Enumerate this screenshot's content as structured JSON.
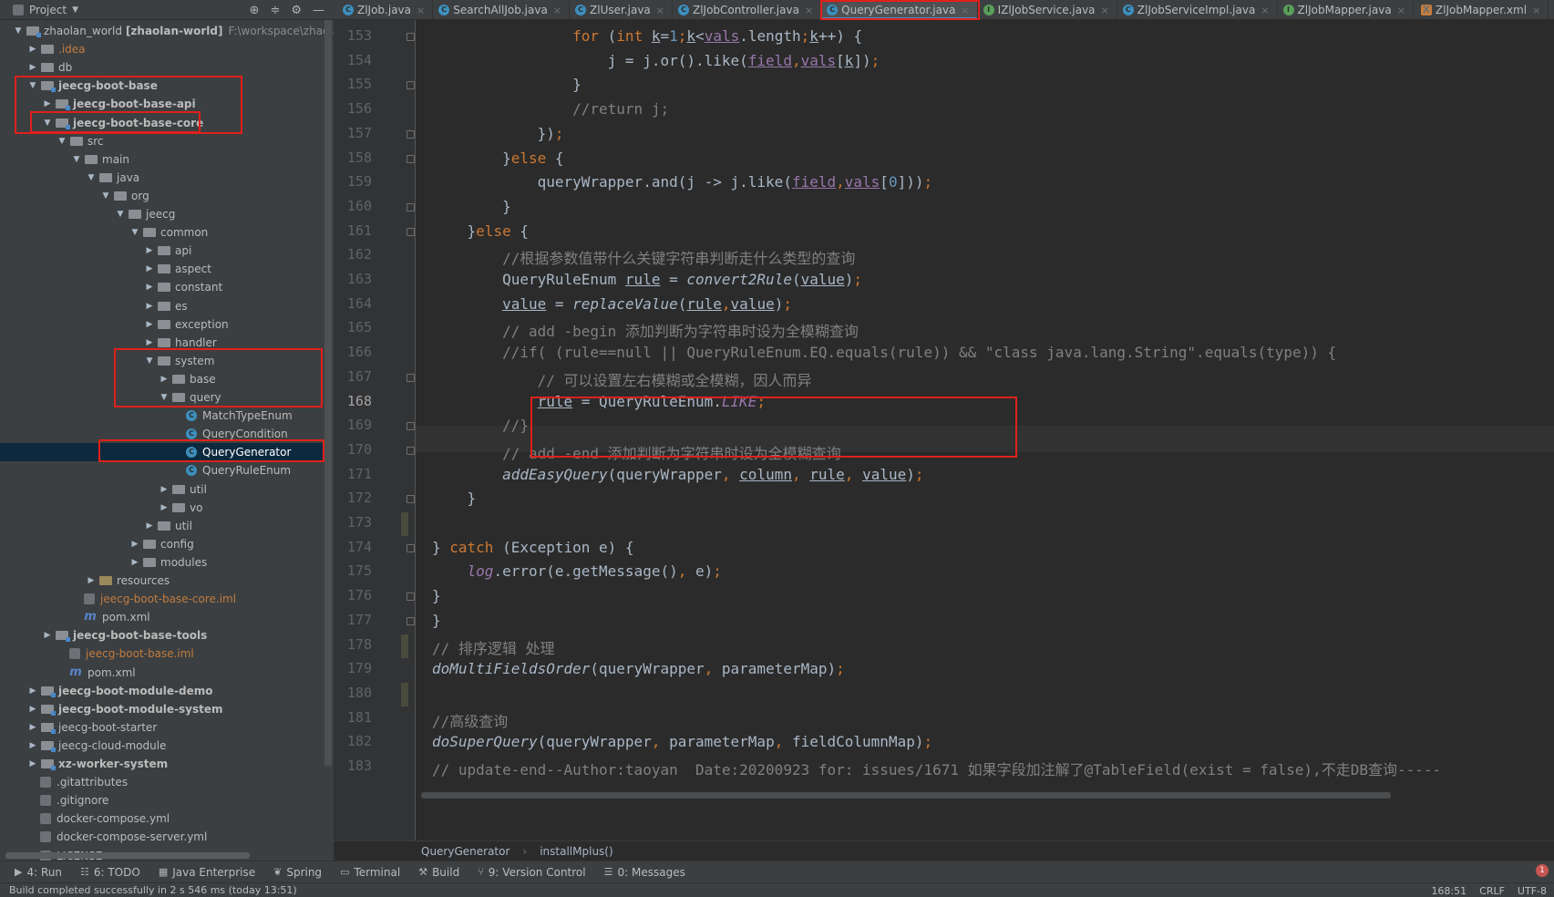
{
  "project_header": {
    "label": "Project"
  },
  "tabs": [
    {
      "label": "ZlJob.java",
      "icon": "class-icon",
      "active": false
    },
    {
      "label": "SearchAllJob.java",
      "icon": "class-icon",
      "active": false
    },
    {
      "label": "ZlUser.java",
      "icon": "class-icon",
      "active": false
    },
    {
      "label": "ZlJobController.java",
      "icon": "class-icon",
      "active": false
    },
    {
      "label": "QueryGenerator.java",
      "icon": "class-icon",
      "active": true
    },
    {
      "label": "IZlJobService.java",
      "icon": "interface-icon",
      "active": false
    },
    {
      "label": "ZlJobServiceImpl.java",
      "icon": "class-icon",
      "active": false
    },
    {
      "label": "ZlJobMapper.java",
      "icon": "interface-icon",
      "active": false
    },
    {
      "label": "ZlJobMapper.xml",
      "icon": "xml-icon",
      "active": false
    }
  ],
  "tree": [
    {
      "label": "zhaolan_world",
      "extra": "[zhaolan-world]",
      "path": "F:\\workspace\\zhaolan",
      "indent": 0,
      "arrow": "down",
      "icon": "module",
      "bold": false
    },
    {
      "label": ".idea",
      "indent": 1,
      "arrow": "right",
      "icon": "folder",
      "style": "orange"
    },
    {
      "label": "db",
      "indent": 1,
      "arrow": "right",
      "icon": "folder"
    },
    {
      "label": "jeecg-boot-base",
      "indent": 1,
      "arrow": "down",
      "icon": "module",
      "bold": true
    },
    {
      "label": "jeecg-boot-base-api",
      "indent": 2,
      "arrow": "right",
      "icon": "module",
      "bold": true
    },
    {
      "label": "jeecg-boot-base-core",
      "indent": 2,
      "arrow": "down",
      "icon": "module",
      "bold": true
    },
    {
      "label": "src",
      "indent": 3,
      "arrow": "down",
      "icon": "folder"
    },
    {
      "label": "main",
      "indent": 4,
      "arrow": "down",
      "icon": "folder"
    },
    {
      "label": "java",
      "indent": 5,
      "arrow": "down",
      "icon": "folder"
    },
    {
      "label": "org",
      "indent": 6,
      "arrow": "down",
      "icon": "folder"
    },
    {
      "label": "jeecg",
      "indent": 7,
      "arrow": "down",
      "icon": "folder"
    },
    {
      "label": "common",
      "indent": 8,
      "arrow": "down",
      "icon": "folder"
    },
    {
      "label": "api",
      "indent": 9,
      "arrow": "right",
      "icon": "folder"
    },
    {
      "label": "aspect",
      "indent": 9,
      "arrow": "right",
      "icon": "folder"
    },
    {
      "label": "constant",
      "indent": 9,
      "arrow": "right",
      "icon": "folder"
    },
    {
      "label": "es",
      "indent": 9,
      "arrow": "right",
      "icon": "folder"
    },
    {
      "label": "exception",
      "indent": 9,
      "arrow": "right",
      "icon": "folder"
    },
    {
      "label": "handler",
      "indent": 9,
      "arrow": "right",
      "icon": "folder"
    },
    {
      "label": "system",
      "indent": 9,
      "arrow": "down",
      "icon": "folder"
    },
    {
      "label": "base",
      "indent": 10,
      "arrow": "right",
      "icon": "folder"
    },
    {
      "label": "query",
      "indent": 10,
      "arrow": "down",
      "icon": "folder"
    },
    {
      "label": "MatchTypeEnum",
      "indent": 11,
      "arrow": "",
      "icon": "class"
    },
    {
      "label": "QueryCondition",
      "indent": 11,
      "arrow": "",
      "icon": "class"
    },
    {
      "label": "QueryGenerator",
      "indent": 11,
      "arrow": "",
      "icon": "class",
      "selected": true
    },
    {
      "label": "QueryRuleEnum",
      "indent": 11,
      "arrow": "",
      "icon": "class"
    },
    {
      "label": "util",
      "indent": 10,
      "arrow": "right",
      "icon": "folder"
    },
    {
      "label": "vo",
      "indent": 10,
      "arrow": "right",
      "icon": "folder"
    },
    {
      "label": "util",
      "indent": 9,
      "arrow": "right",
      "icon": "folder"
    },
    {
      "label": "config",
      "indent": 8,
      "arrow": "right",
      "icon": "folder"
    },
    {
      "label": "modules",
      "indent": 8,
      "arrow": "right",
      "icon": "folder"
    },
    {
      "label": "resources",
      "indent": 5,
      "arrow": "right",
      "icon": "resfolder"
    },
    {
      "label": "jeecg-boot-base-core.iml",
      "indent": 4,
      "arrow": "",
      "icon": "file",
      "style": "orange"
    },
    {
      "label": "pom.xml",
      "indent": 4,
      "arrow": "",
      "icon": "maven"
    },
    {
      "label": "jeecg-boot-base-tools",
      "indent": 2,
      "arrow": "right",
      "icon": "module",
      "bold": true
    },
    {
      "label": "jeecg-boot-base.iml",
      "indent": 3,
      "arrow": "",
      "icon": "file",
      "style": "orange"
    },
    {
      "label": "pom.xml",
      "indent": 3,
      "arrow": "",
      "icon": "maven"
    },
    {
      "label": "jeecg-boot-module-demo",
      "indent": 1,
      "arrow": "right",
      "icon": "module",
      "bold": true
    },
    {
      "label": "jeecg-boot-module-system",
      "indent": 1,
      "arrow": "right",
      "icon": "module",
      "bold": true
    },
    {
      "label": "jeecg-boot-starter",
      "indent": 1,
      "arrow": "right",
      "icon": "module"
    },
    {
      "label": "jeecg-cloud-module",
      "indent": 1,
      "arrow": "right",
      "icon": "module"
    },
    {
      "label": "xz-worker-system",
      "indent": 1,
      "arrow": "right",
      "icon": "module",
      "bold": true
    },
    {
      "label": ".gitattributes",
      "indent": 1,
      "arrow": "",
      "icon": "file"
    },
    {
      "label": ".gitignore",
      "indent": 1,
      "arrow": "",
      "icon": "file"
    },
    {
      "label": "docker-compose.yml",
      "indent": 1,
      "arrow": "",
      "icon": "file"
    },
    {
      "label": "docker-compose-server.yml",
      "indent": 1,
      "arrow": "",
      "icon": "file"
    },
    {
      "label": "LICENSE",
      "indent": 1,
      "arrow": "",
      "icon": "file"
    }
  ],
  "editor": {
    "current_line": "168",
    "lines": [
      {
        "n": "153",
        "html": "                <span class=\"kw\">for</span> (<span class=\"kw\">int</span> <span class=\"ul\">k</span>=<span class=\"num\">1</span><span class=\"punc\">;</span><span class=\"ul\">k</span>&lt;<span class=\"fld\">vals</span>.length<span class=\"punc\">;</span><span class=\"ul\">k</span>++) {"
      },
      {
        "n": "154",
        "html": "                    j = j.or().like(<span class=\"fld\">field</span><span class=\"punc\">,</span><span class=\"fld\">vals</span>[<span class=\"ul\">k</span>])<span class=\"punc\">;</span>"
      },
      {
        "n": "155",
        "html": "                }"
      },
      {
        "n": "156",
        "html": "                <span class=\"cm\">//return j;</span>"
      },
      {
        "n": "157",
        "html": "            })<span class=\"punc\">;</span>"
      },
      {
        "n": "158",
        "html": "        }<span class=\"kw\">else</span> {"
      },
      {
        "n": "159",
        "html": "            queryWrapper.and(j -&gt; j.like(<span class=\"fld\">field</span><span class=\"punc\">,</span><span class=\"fld\">vals</span>[<span class=\"num\">0</span>]))<span class=\"punc\">;</span>"
      },
      {
        "n": "160",
        "html": "        }"
      },
      {
        "n": "161",
        "html": "    }<span class=\"kw\">else</span> {"
      },
      {
        "n": "162",
        "html": "        <span class=\"cm\">//根据参数值带什么关键字符串判断走什么类型的查询</span>"
      },
      {
        "n": "163",
        "html": "        QueryRuleEnum <span class=\"ul\">rule</span> = <span class=\"it\">convert2Rule</span>(<span class=\"ul\">value</span>)<span class=\"punc\">;</span>"
      },
      {
        "n": "164",
        "html": "        <span class=\"ul\">value</span> = <span class=\"it\">replaceValue</span>(<span class=\"ul\">rule</span><span class=\"punc\">,</span><span class=\"ul\">value</span>)<span class=\"punc\">;</span>"
      },
      {
        "n": "165",
        "html": "        <span class=\"cm\">// add -begin 添加判断为字符串时设为全模糊查询</span>"
      },
      {
        "n": "166",
        "html": "        <span class=\"cm\">//if( (rule==null || QueryRuleEnum.EQ.equals(rule)) &amp;&amp; \"class java.lang.String\".equals(type)) {</span>"
      },
      {
        "n": "167",
        "html": "            <span class=\"cm\">// 可以设置左右模糊或全模糊，因人而异</span>"
      },
      {
        "n": "168",
        "html": "            <span class=\"ul\">rule</span> = QueryRuleEnum.<span class=\"cst\">LIKE</span><span class=\"punc\">;</span>"
      },
      {
        "n": "169",
        "html": "        <span class=\"cm\">//}</span>"
      },
      {
        "n": "170",
        "html": "        <span class=\"cm\">// add -end 添加判断为字符串时设为全模糊查询</span>"
      },
      {
        "n": "171",
        "html": "        <span class=\"it\">addEasyQuery</span>(queryWrapper<span class=\"punc\">,</span> <span class=\"ul\">column</span><span class=\"punc\">,</span> <span class=\"ul\">rule</span><span class=\"punc\">,</span> <span class=\"ul\">value</span>)<span class=\"punc\">;</span>"
      },
      {
        "n": "172",
        "html": "    }"
      },
      {
        "n": "173",
        "html": ""
      },
      {
        "n": "174",
        "html": "} <span class=\"kw\">catch</span> (Exception e) {"
      },
      {
        "n": "175",
        "html": "    <span class=\"cst\">log</span>.error(e.getMessage()<span class=\"punc\">,</span> e)<span class=\"punc\">;</span>"
      },
      {
        "n": "176",
        "html": "}"
      },
      {
        "n": "177",
        "html": "}"
      },
      {
        "n": "178",
        "html": "<span class=\"cm\">// 排序逻辑 处理</span>"
      },
      {
        "n": "179",
        "html": "<span class=\"it\">doMultiFieldsOrder</span>(queryWrapper<span class=\"punc\">,</span> parameterMap)<span class=\"punc\">;</span>"
      },
      {
        "n": "180",
        "html": ""
      },
      {
        "n": "181",
        "html": "<span class=\"cm\">//高级查询</span>"
      },
      {
        "n": "182",
        "html": "<span class=\"it\">doSuperQuery</span>(queryWrapper<span class=\"punc\">,</span> parameterMap<span class=\"punc\">,</span> fieldColumnMap)<span class=\"punc\">;</span>"
      },
      {
        "n": "183",
        "html": "<span class=\"cm\">// update-end--Author:taoyan  Date:20200923 for: issues/1671 如果字段加注解了@TableField(exist = false),不走DB查询-----</span>"
      }
    ]
  },
  "breadcrumb": {
    "class": "QueryGenerator",
    "method": "installMplus()"
  },
  "toolwindows": [
    {
      "label": "4: Run",
      "icon": "run-icon"
    },
    {
      "label": "6: TODO",
      "icon": "todo-icon"
    },
    {
      "label": "Java Enterprise",
      "icon": "enterprise-icon"
    },
    {
      "label": "Spring",
      "icon": "spring-icon"
    },
    {
      "label": "Terminal",
      "icon": "terminal-icon"
    },
    {
      "label": "Build",
      "icon": "build-icon"
    },
    {
      "label": "9: Version Control",
      "icon": "vcs-icon"
    },
    {
      "label": "0: Messages",
      "icon": "messages-icon"
    }
  ],
  "status": {
    "message": "Build completed successfully in 2 s 546 ms (today 13:51)",
    "position": "168:51",
    "line_sep": "CRLF",
    "encoding": "UTF-8",
    "error_count": "1"
  },
  "colors": {
    "highlight_box": "#e0201b",
    "accent": "#4a88c7"
  }
}
